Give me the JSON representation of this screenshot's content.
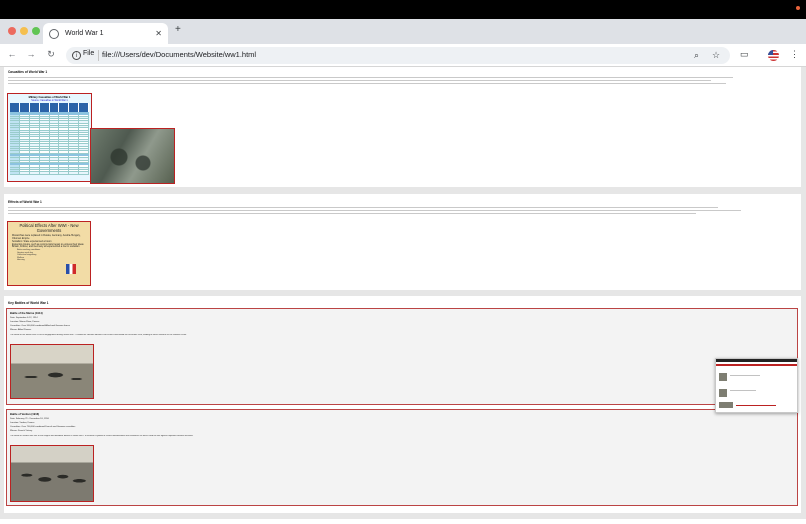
{
  "browser": {
    "tab_title": "World War 1",
    "scheme_chip": "File",
    "url": "file:///Users/dev/Documents/Website/ww1.html",
    "icons": {
      "tab_favicon": "globe-icon",
      "close": "close-icon",
      "new_tab": "plus-icon",
      "back": "arrow-left-icon",
      "forward": "arrow-right-icon",
      "reload": "reload-icon",
      "site_info": "info-icon",
      "zoom": "magnifier-icon",
      "bookmark": "star-icon",
      "cast": "cast-icon",
      "profile": "us-flag-avatar-icon",
      "menu": "kebab-menu-icon"
    }
  },
  "page": {
    "sections": [
      {
        "title": "Casualties of World War 1",
        "casualty_table": {
          "title": "Military Casualties of World War 1",
          "subtitle": "Source: Casualties in World War 1"
        }
      },
      {
        "title": "Effects of World War 1",
        "effects_box": {
          "title": "Political Effects After WWI - New Governments",
          "bullets": [
            "Monarchies were replaced in Russia, Germany, Austria-Hungary, Ottoman Empire",
            "Socialism: State experienced a boom",
            "Extremist groups, such as communists began to express their ideas",
            "Britain, France, and Germany all experienced a rise in socialism"
          ],
          "sub_bullets": [
            "Better working conditions",
            "Greater work day",
            "Collective bargaining",
            "Welfare",
            "Housing"
          ]
        }
      },
      {
        "title": "Key Battles of World War 1",
        "battles": [
          {
            "name": "Battle of the Marne (1914)",
            "date": "Date: September 6-12, 1914",
            "location": "Location: Marne River, France",
            "casualties": "Casualties: Over 500,000 combined Allied and German forces",
            "winner": "Winner: Allied Powers",
            "description": "The Battle of the Marne was a crucial engagement during World War I. It halted the German advance into France and ended the Schlieffen Plan, leading to trench warfare on the Western Front."
          },
          {
            "name": "Battle of Verdun (1916)",
            "date": "Date: February 21 - December 18, 1916",
            "location": "Location: Verdun, France",
            "casualties": "Casualties: Over 700,000 combined French and German casualties",
            "winner": "Winner: French Victory",
            "description": "The Battle of Verdun was one of the longest and bloodiest battles of World War I. It became a symbol of French determination and resistance as forces held the line against repeated German assaults."
          }
        ]
      }
    ]
  }
}
